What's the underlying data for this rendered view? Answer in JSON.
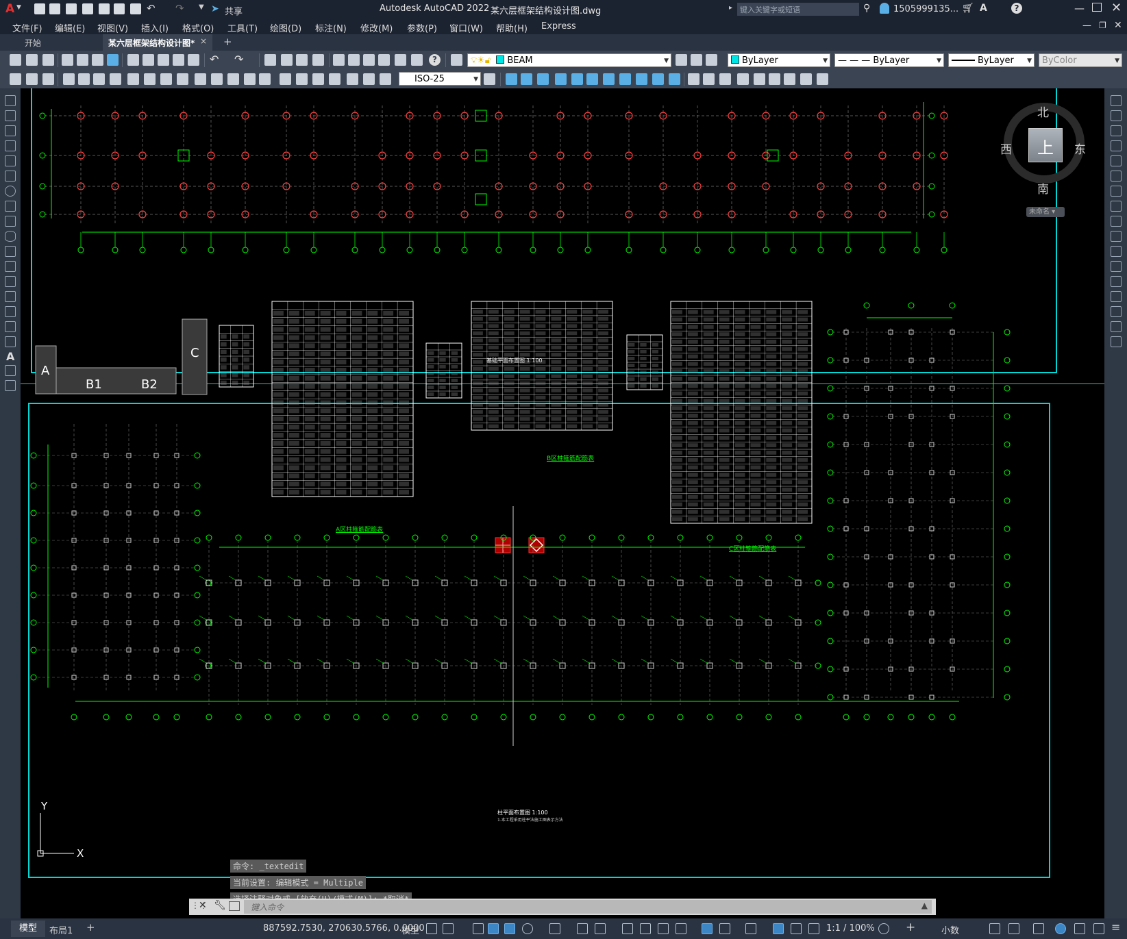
{
  "titlebar": {
    "logo": "A",
    "app_title": "Autodesk AutoCAD 2022",
    "file_title": "某六层框架结构设计图.dwg",
    "share_label": "共享",
    "search_placeholder": "键入关键字或短语",
    "user": "1505999135...",
    "help": "?"
  },
  "menu": {
    "items": [
      "文件(F)",
      "编辑(E)",
      "视图(V)",
      "插入(I)",
      "格式(O)",
      "工具(T)",
      "绘图(D)",
      "标注(N)",
      "修改(M)",
      "参数(P)",
      "窗口(W)",
      "帮助(H)",
      "Express"
    ]
  },
  "tabs": {
    "start": "开始",
    "doc": "某六层框架结构设计图*",
    "close": "×",
    "add": "+"
  },
  "toolbar": {
    "layer": "BEAM",
    "color": "ByLayer",
    "linetype": "— — — ByLayer",
    "lineweight": "ByLayer",
    "plotstyle": "ByColor",
    "dimstyle": "ISO-25"
  },
  "viewcube": {
    "north": "北",
    "south": "南",
    "east": "东",
    "west": "西",
    "top": "上",
    "wcs": "未命名"
  },
  "drawing": {
    "plan_title_upper": "基础平面布置图 1:100",
    "plan_title_lower": "柱平面布置图 1:100",
    "table_a_title": "A区柱箍筋配筋表",
    "table_b_title": "B区柱箍筋配筋表",
    "table_c_title": "C区柱箍筋配筋表",
    "key_plan": {
      "a": "A",
      "b1": "B1",
      "b2": "B2",
      "c": "C"
    },
    "note": "1.本工程采用柱平法施工图表示方法"
  },
  "command": {
    "history": [
      "命令: _textedit",
      "当前设置: 编辑模式 = Multiple",
      "选择注释对象或 [放弃(U)/模式(M)]: *取消*"
    ],
    "placeholder": "键入命令"
  },
  "ucs": {
    "x": "X",
    "y": "Y"
  },
  "status": {
    "tab_model": "模型",
    "tab_layout": "布局1",
    "add": "+",
    "coords": "887592.7530, 270630.5766, 0.0000",
    "space": "模型",
    "scale": "1:1 / 100%",
    "units": "小数"
  }
}
